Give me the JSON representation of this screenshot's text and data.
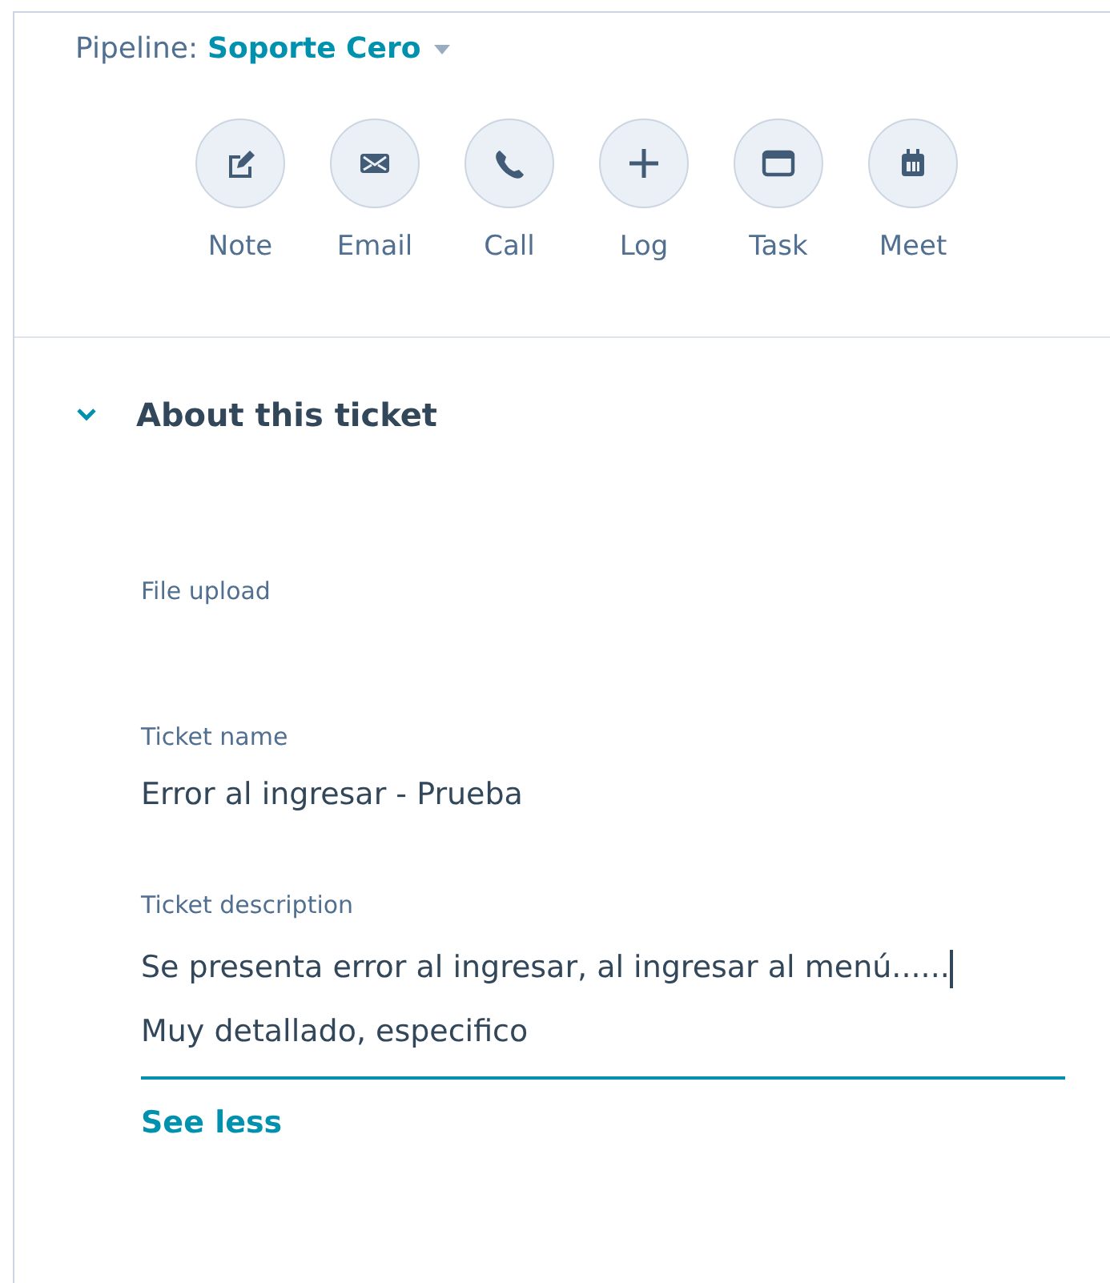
{
  "pipeline": {
    "label": "Pipeline:",
    "value": "Soporte Cero"
  },
  "actions": [
    {
      "kind": "note",
      "label": "Note"
    },
    {
      "kind": "email",
      "label": "Email"
    },
    {
      "kind": "call",
      "label": "Call"
    },
    {
      "kind": "log",
      "label": "Log"
    },
    {
      "kind": "task",
      "label": "Task"
    },
    {
      "kind": "meet",
      "label": "Meet"
    }
  ],
  "section": {
    "title": "About this ticket",
    "expanded": true,
    "fields": [
      {
        "label": "File upload"
      },
      {
        "label": "Ticket name",
        "value": "Error al ingresar - Prueba"
      },
      {
        "label": "Ticket description",
        "value_lines": [
          "Se presenta error al ingresar, al ingresar al menú......",
          "Muy detallado, especifico"
        ],
        "focused": true
      }
    ],
    "toggle": "See less"
  }
}
